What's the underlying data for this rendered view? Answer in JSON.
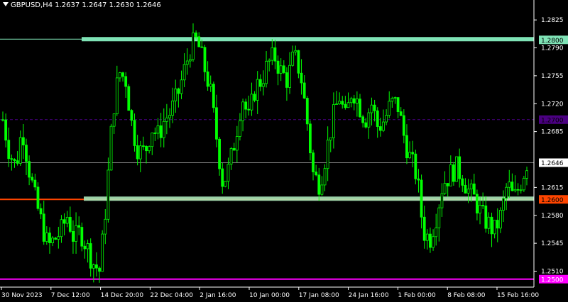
{
  "header": {
    "symbol_info": "GBPUSD,H4  1.2637 1.2647 1.2630 1.2646"
  },
  "colors": {
    "background": "#000000",
    "candle": "#00ff00",
    "axis_text": "#ffffff",
    "resistance_band": "#7fe3b6",
    "support_band": "#a8e6b8",
    "level_1_26": "#ff4500",
    "level_1_25": "#ff00ff",
    "level_1_27": "#4b0082",
    "current_price": "#808080"
  },
  "chart_data": {
    "type": "candlestick",
    "title": "GBPUSD,H4",
    "ohlc_header": {
      "open": 1.2637,
      "high": 1.2647,
      "low": 1.263,
      "close": 1.2646
    },
    "ylim": [
      1.249,
      1.285
    ],
    "y_ticks": [
      "1.2825",
      "1.2790",
      "1.2755",
      "1.2720",
      "1.2685",
      "1.2615",
      "1.2580",
      "1.2545",
      "1.2510"
    ],
    "x_ticks": [
      "30 Nov 2023",
      "7 Dec 12:00",
      "14 Dec 20:00",
      "22 Dec 04:00",
      "2 Jan 16:00",
      "10 Jan 00:00",
      "17 Jan 08:00",
      "24 Jan 16:00",
      "1 Feb 00:00",
      "8 Feb 08:00",
      "15 Feb 16:00"
    ],
    "grid": false,
    "levels": [
      {
        "price": 1.28,
        "label": "1.2800",
        "kind": "resistance-band"
      },
      {
        "price": 1.27,
        "label": "1.2700",
        "kind": "dashed-line"
      },
      {
        "price": 1.2646,
        "label": "1.2646",
        "kind": "current-price"
      },
      {
        "price": 1.26,
        "label": "1.2600",
        "kind": "support-band"
      },
      {
        "price": 1.25,
        "label": "1.2500",
        "kind": "horizontal-line"
      }
    ],
    "close_path": [
      1.27,
      1.266,
      1.264,
      1.269,
      1.264,
      1.26,
      1.257,
      1.254,
      1.255,
      1.256,
      1.258,
      1.255,
      1.256,
      1.254,
      1.252,
      1.251,
      1.26,
      1.271,
      1.276,
      1.275,
      1.269,
      1.266,
      1.266,
      1.269,
      1.268,
      1.27,
      1.271,
      1.273,
      1.276,
      1.279,
      1.28,
      1.277,
      1.274,
      1.268,
      1.262,
      1.264,
      1.268,
      1.273,
      1.27,
      1.274,
      1.275,
      1.277,
      1.278,
      1.276,
      1.275,
      1.278,
      1.276,
      1.27,
      1.263,
      1.262,
      1.266,
      1.27,
      1.273,
      1.27,
      1.274,
      1.272,
      1.27,
      1.272,
      1.269,
      1.27,
      1.272,
      1.272,
      1.268,
      1.265,
      1.263,
      1.256,
      1.255,
      1.258,
      1.262,
      1.263,
      1.264,
      1.263,
      1.261,
      1.26,
      1.258,
      1.257,
      1.256,
      1.258,
      1.262,
      1.26,
      1.262,
      1.2646
    ]
  }
}
